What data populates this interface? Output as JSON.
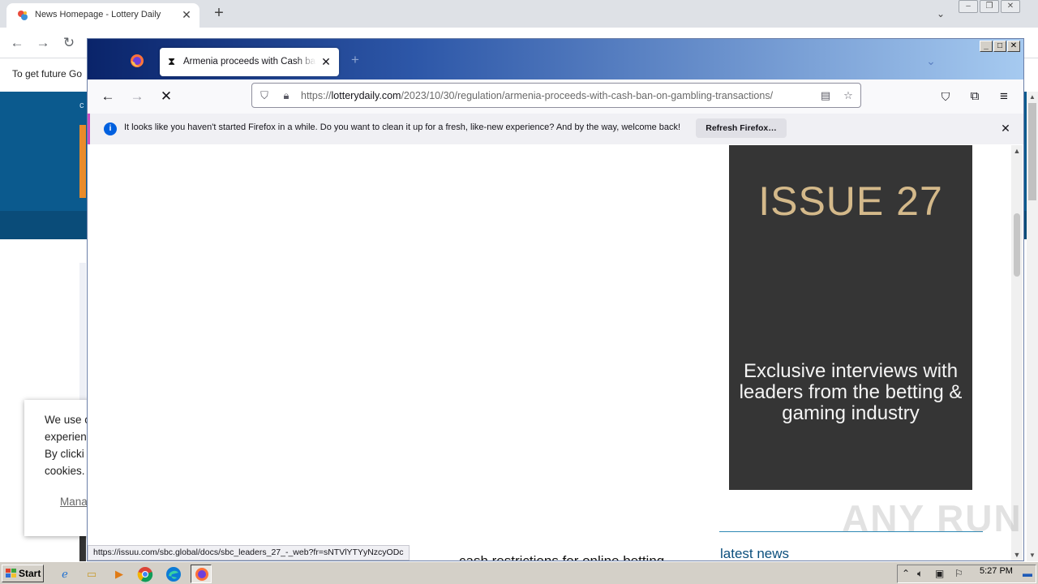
{
  "chrome": {
    "tab_title": "News Homepage - Lottery Daily",
    "banner_text": "To get future Go",
    "bg_blue_char": "c"
  },
  "cookie": {
    "line1": "We use c",
    "line2": "experien",
    "line3": "By clicki",
    "line4": "cookies.",
    "manage": "Mana"
  },
  "firefox": {
    "tab_title": "Armenia proceeds with Cash ban on gambling transactions",
    "url_domain": "lotterydaily.com",
    "url_prefix": "https://",
    "url_path": "/2023/10/30/regulation/armenia-proceeds-with-cash-ban-on-gambling-transactions/",
    "notification_text": "It looks like you haven't started Firefox in a while. Do you want to clean it up for a fresh, like-new experience? And by the way, welcome back!",
    "refresh_button": "Refresh Firefox…",
    "status_url": "https://issuu.com/sbc.global/docs/sbc_leaders_27_-_web?fr=sNTVlYTYyNzcyODc"
  },
  "content": {
    "ad_issue": "ISSUE 27",
    "ad_subtitle": "Exclusive interviews with leaders from the betting & gaming industry",
    "latest_news": "latest news",
    "headline_fragment": "cash restrictions for online betting"
  },
  "watermark": "ANY RUN",
  "taskbar": {
    "start": "Start",
    "clock": "5:27 PM"
  },
  "colors": {
    "firefox_title_gradient_start": "#0a246a",
    "ad_background": "#353535",
    "ad_issue_text": "#d4b98a",
    "news_accent": "#0b4f7d"
  }
}
